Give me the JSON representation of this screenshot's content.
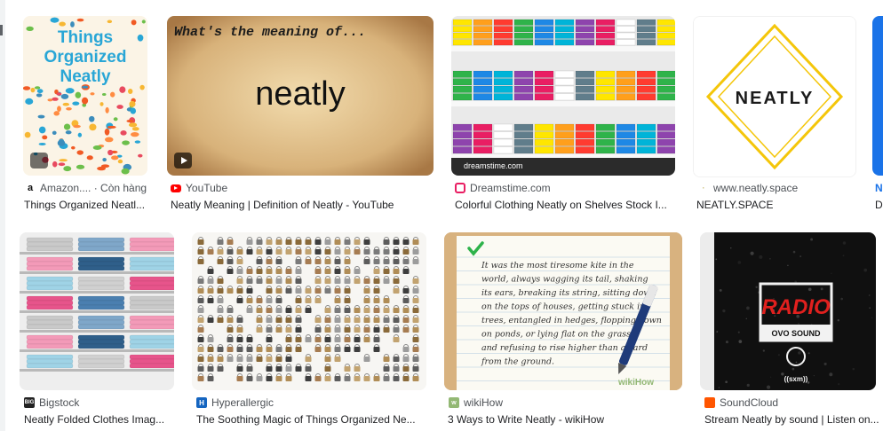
{
  "row1": [
    {
      "source": "Amazon.... · Còn hàng",
      "caption": "Things Organized Neatl...",
      "favicon": "amazon-icon",
      "thumb_text": [
        "Things",
        "Organized",
        "Neatly"
      ]
    },
    {
      "source": "YouTube",
      "caption": "Neatly Meaning | Definition of Neatly - YouTube",
      "favicon": "youtube-icon",
      "thumb_top": "What's the meaning of...",
      "thumb_word": "neatly"
    },
    {
      "source": "Dreamstime.com",
      "caption": "Colorful Clothing Neatly on Shelves Stock I...",
      "favicon": "dreamstime-icon",
      "watermark": "dreamstime.com"
    },
    {
      "source": "www.neatly.space",
      "caption": "NEATLY.SPACE",
      "favicon": "neatly-icon",
      "logo": "NEATLY"
    },
    {
      "source": "N",
      "caption": "D"
    }
  ],
  "row2": [
    {
      "source": "Bigstock",
      "caption": "Neatly Folded Clothes Imag...",
      "favicon": "bigstock-icon",
      "favicon_text": "BIG"
    },
    {
      "source": "Hyperallergic",
      "caption": "The Soothing Magic of Things Organized Ne...",
      "favicon": "hyperallergic-icon",
      "favicon_text": "H"
    },
    {
      "source": "wikiHow",
      "caption": "3 Ways to Write Neatly - wikiHow",
      "favicon": "wikihow-icon",
      "handwriting": [
        "It was the most tiresome kite in the",
        "world, always wagging its tail, shaking",
        "its ears, breaking its string, sitting down",
        "on the tops of houses, getting stuck in",
        "trees, entangled in hedges, flopping down",
        "on ponds, or lying flat on the grass",
        "and refusing to rise higher than a yard",
        "from the ground."
      ],
      "watermark": "wikiHow"
    },
    {
      "source": "SoundCloud",
      "caption": "Stream Neatly by sound | Listen on...",
      "favicon": "soundcloud-icon",
      "radio": "RADIO",
      "ovo": "OVO SOUND",
      "sxm": "((sxm))"
    }
  ],
  "colors": {
    "link": "#1a73e8",
    "youtube": "#ff0000",
    "dreamstime": "#e91e63",
    "hyperallergic": "#1565c0",
    "wikihow": "#93b874",
    "soundcloud": "#ff5500"
  }
}
